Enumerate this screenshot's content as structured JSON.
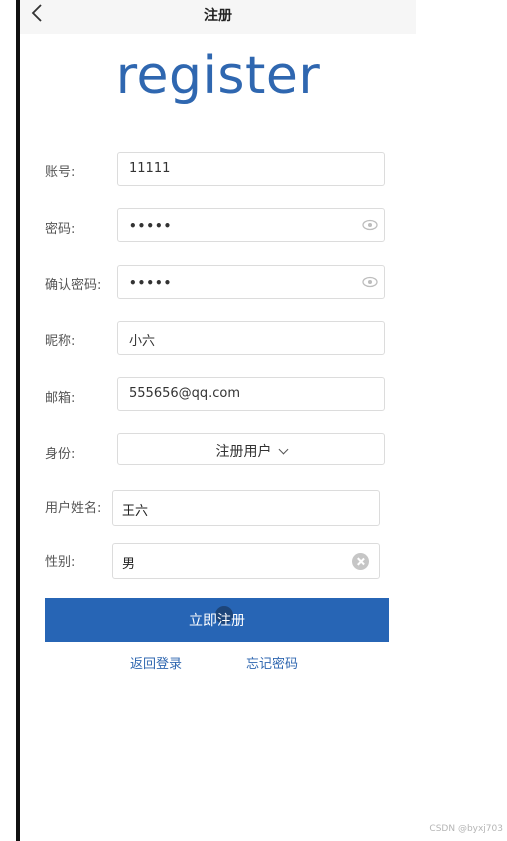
{
  "topbar": {
    "title": "注册"
  },
  "logo": "register",
  "form": {
    "account_label": "账号:",
    "account_value": "11111",
    "password_label": "密码:",
    "password_value": "•••••",
    "confirm_label": "确认密码:",
    "confirm_value": "•••••",
    "nickname_label": "昵称:",
    "nickname_value": "小六",
    "email_label": "邮箱:",
    "email_value": "555656@qq.com",
    "identity_label": "身份:",
    "identity_value": "注册用户",
    "realname_label": "用户姓名:",
    "realname_value": "王六",
    "gender_label": "性别:",
    "gender_value": "男"
  },
  "actions": {
    "submit": "立即注册",
    "back_login": "返回登录",
    "forgot_password": "忘记密码"
  },
  "watermark": "CSDN @byxj703",
  "colors": {
    "accent": "#2765b5",
    "logo": "#2f67b0"
  }
}
